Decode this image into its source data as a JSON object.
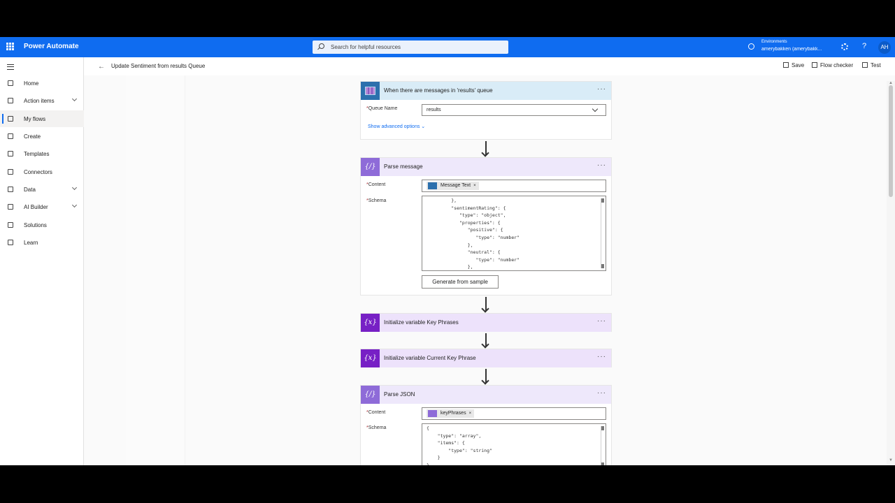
{
  "topbar": {
    "app_title": "Power Automate",
    "search_placeholder": "Search for helpful resources",
    "env_label": "Environments",
    "env_name": "amerybakken (amerybakk...",
    "help": "?",
    "avatar_initials": "AH"
  },
  "nav": {
    "items": [
      {
        "label": "Home"
      },
      {
        "label": "Action items"
      },
      {
        "label": "My flows"
      },
      {
        "label": "Create"
      },
      {
        "label": "Templates"
      },
      {
        "label": "Connectors"
      },
      {
        "label": "Data"
      },
      {
        "label": "AI Builder"
      },
      {
        "label": "Solutions"
      },
      {
        "label": "Learn"
      }
    ]
  },
  "header": {
    "back": "←",
    "flow_name": "Update Sentiment from results Queue",
    "save": "Save",
    "flow_checker": "Flow checker",
    "test": "Test"
  },
  "cards": {
    "trigger": {
      "title": "When there are messages in 'results' queue",
      "queue_label": "Queue Name",
      "queue_value": "results",
      "advanced": "Show advanced options"
    },
    "parse_message": {
      "title": "Parse message",
      "content_label": "Content",
      "content_token": "Message Text",
      "schema_label": "Schema",
      "schema_text": "         },\n         \"sentimentRating\": {\n            \"type\": \"object\",\n            \"properties\": {\n               \"positive\": {\n                  \"type\": \"number\"\n               },\n               \"neutral\": {\n                  \"type\": \"number\"\n               },",
      "generate_button": "Generate from sample"
    },
    "init_key_phrases": {
      "title": "Initialize variable Key Phrases"
    },
    "init_current_key_phrase": {
      "title": "Initialize variable Current Key Phrase"
    },
    "parse_json": {
      "title": "Parse JSON",
      "content_label": "Content",
      "content_token": "keyPhrases",
      "schema_label": "Schema",
      "schema_text": "{\n    \"type\": \"array\",\n    \"items\": {\n        \"type\": \"string\"\n    }\n}"
    }
  },
  "common": {
    "required_marker": "*",
    "more": "···",
    "token_close": "×",
    "var_badge": "{x}",
    "parse_badge": "{/}"
  },
  "colors": {
    "topbar": "#0f6cf0",
    "queue_header": "#d9ecf7",
    "parse_header": "#eee8fb",
    "variable_header": "#ede2fb",
    "variable_badge": "#7720c5",
    "parse_badge": "#8e6bd8"
  }
}
